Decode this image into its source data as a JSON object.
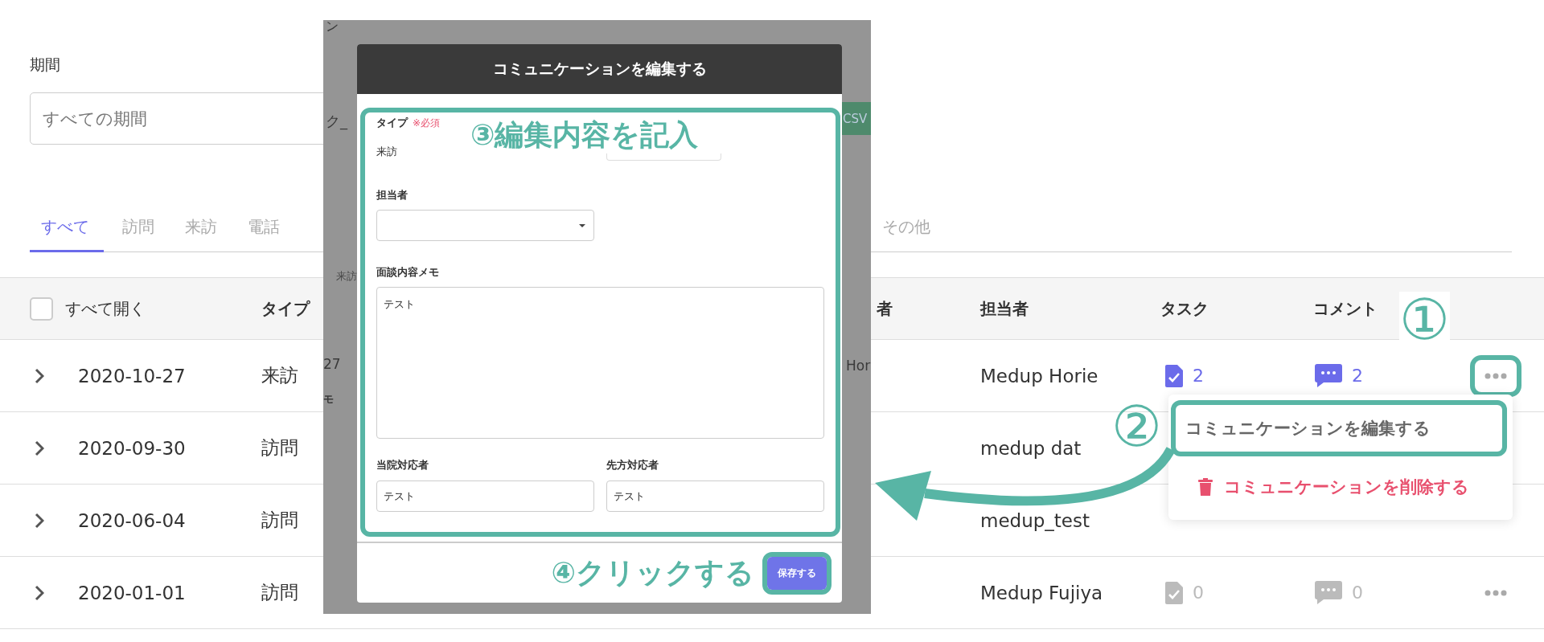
{
  "filter": {
    "label": "期間",
    "placeholder": "すべての期間"
  },
  "tabs": [
    {
      "label": "すべて",
      "selected": true
    },
    {
      "label": "訪問",
      "selected": false
    },
    {
      "label": "来訪",
      "selected": false
    },
    {
      "label": "電話",
      "selected": false
    },
    {
      "label": "その他",
      "selected": false
    }
  ],
  "table": {
    "select_all": {
      "label": "すべて開く",
      "checked": false
    },
    "columns": [
      "タイプ",
      "者",
      "担当者",
      "タスク",
      "コメント"
    ],
    "rows": [
      {
        "date": "2020-10-27",
        "type": "来訪",
        "staff": "Medup Horie",
        "tasks": "2",
        "comments": "2",
        "active": true,
        "more": {
          "highlighted": true
        }
      },
      {
        "date": "2020-09-30",
        "type": "訪問",
        "staff": "medup dat"
      },
      {
        "date": "2020-06-04",
        "type": "訪問",
        "staff": "medup_test"
      },
      {
        "date": "2020-01-01",
        "type": "訪問",
        "staff": "Medup Fujiya",
        "tasks": "0",
        "comments": "0",
        "active": false,
        "more": {
          "highlighted": false
        }
      }
    ]
  },
  "background_fragments": [
    "ン",
    "ク_",
    "CSV",
    "来訪",
    "27",
    "モ",
    "Hor"
  ],
  "modal": {
    "title": "コミュニケーションを編集する",
    "type": {
      "label": "タイプ",
      "required": "※必須",
      "value": "来訪"
    },
    "staff": {
      "label": "担当者"
    },
    "memo": {
      "label": "面談内容メモ",
      "value": "テスト"
    },
    "our_contact": {
      "label": "当院対応者",
      "value": "テスト"
    },
    "their_contact": {
      "label": "先方対応者",
      "value": "テスト"
    },
    "save_button": {
      "label": "保存する",
      "highlighted": true
    }
  },
  "menu": {
    "items": [
      {
        "label": "コミュニケーションを編集する",
        "kind": "edit",
        "highlighted": true
      },
      {
        "label": "コミュニケーションを削除する",
        "kind": "delete",
        "highlighted": false
      }
    ]
  },
  "annotations": [
    {
      "kind": "step1",
      "text": "①"
    },
    {
      "kind": "step2",
      "text": "②"
    },
    {
      "kind": "step3",
      "text": "③編集内容を記入"
    },
    {
      "kind": "step4",
      "text": "④クリックする"
    }
  ]
}
